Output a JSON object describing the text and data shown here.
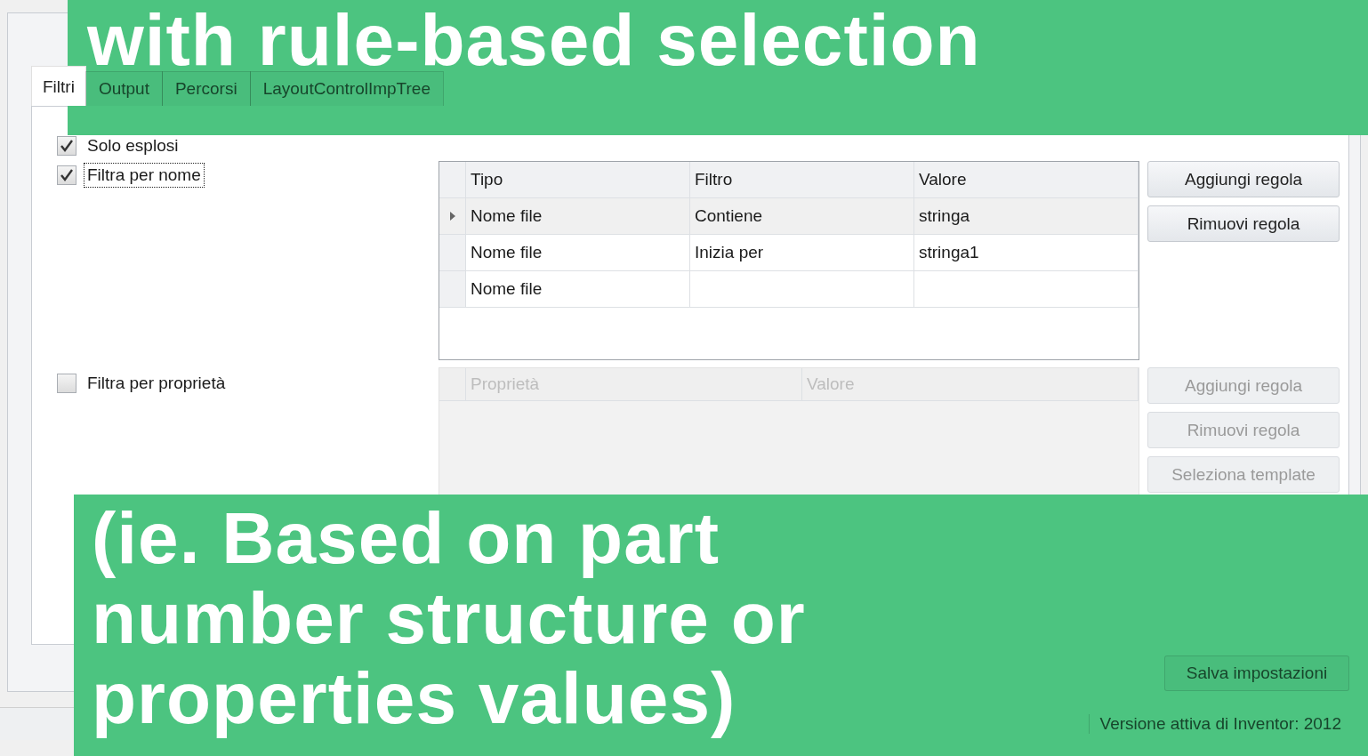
{
  "tabs": [
    {
      "label": "Filtri",
      "selected": true
    },
    {
      "label": "Output",
      "selected": false
    },
    {
      "label": "Percorsi",
      "selected": false
    },
    {
      "label": "LayoutControlImpTree",
      "selected": false
    }
  ],
  "solo_esplosi": {
    "label": "Solo esplosi",
    "checked": true
  },
  "name_filter": {
    "label": "Filtra per nome",
    "checked": true,
    "focused": true,
    "columns": [
      "Tipo",
      "Filtro",
      "Valore"
    ],
    "rows": [
      {
        "cells": [
          "Nome file",
          "Contiene",
          "stringa"
        ],
        "selected": true
      },
      {
        "cells": [
          "Nome file",
          "Inizia per",
          "stringa1"
        ],
        "selected": false
      },
      {
        "cells": [
          "Nome file",
          "",
          ""
        ],
        "selected": false
      }
    ],
    "buttons": [
      "Aggiungi regola",
      "Rimuovi regola"
    ]
  },
  "property_filter": {
    "label": "Filtra per proprietà",
    "checked": false,
    "focused": false,
    "columns": [
      "Proprietà",
      "Valore"
    ],
    "buttons": [
      "Aggiungi regola",
      "Rimuovi regola",
      "Seleziona template"
    ]
  },
  "save_button": "Salva impostazioni",
  "status_bar": {
    "version": "Versione attiva di Inventor: 2012"
  },
  "captions": [
    "with rule-based selection",
    "(ie. Based on part number structure or properties values)"
  ]
}
